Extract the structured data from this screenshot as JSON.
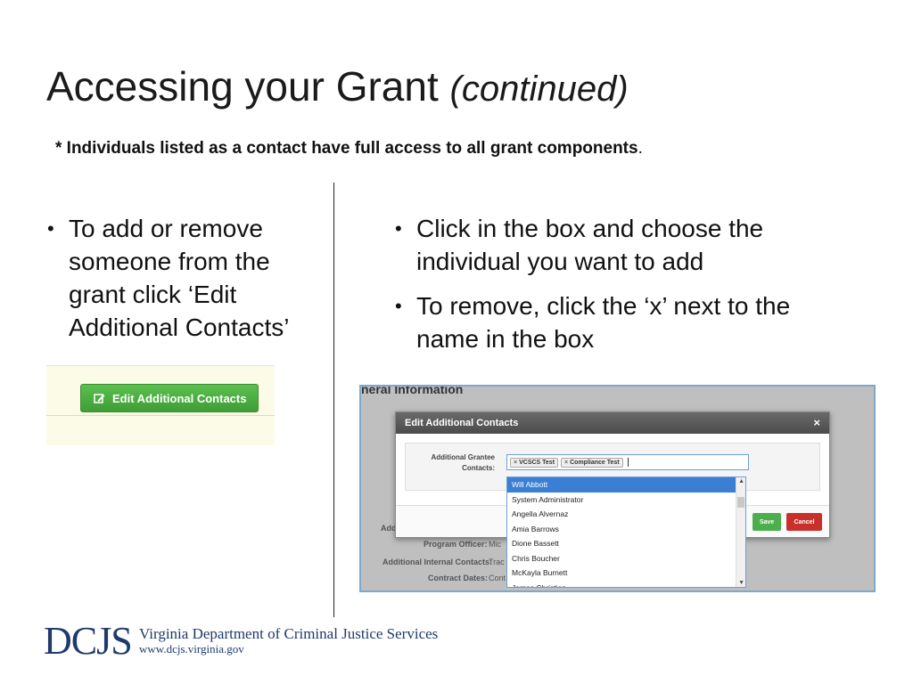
{
  "slide": {
    "title": "Accessing your Grant",
    "title_italic": "(continued)",
    "note_bold": "* Individuals listed as a contact have full access to all grant components",
    "note_end": "."
  },
  "left_bullets": [
    "To add or remove someone from the grant click ‘Edit Additional Contacts’"
  ],
  "right_bullets": [
    "Click in the box and choose the individual you want to add",
    "To remove, click the ‘x’ next to the name in the box"
  ],
  "screenshot_button": {
    "label": "Edit Additional Contacts",
    "icon": "edit-icon",
    "color": "#4cae4c"
  },
  "screenshot_modal": {
    "background_heading": "neral Information",
    "background_rows": [
      {
        "label": "Add",
        "value": ""
      },
      {
        "label": "Program Officer:",
        "value": "Mic"
      },
      {
        "label": "Additional Internal Contacts:",
        "value": "Trac"
      },
      {
        "label": "Contract Dates:",
        "value": "Cont"
      }
    ],
    "modal_title": "Edit Additional Contacts",
    "close_symbol": "×",
    "field_label": "Additional Grantee Contacts:",
    "tags": [
      "VCSCS Test",
      "Compliance Test"
    ],
    "tag_remove_symbol": "×",
    "dropdown_options": [
      "Will Abbott",
      "System Administrator",
      "Angella Alvernaz",
      "Amia Barrows",
      "Dione Bassett",
      "Chris Boucher",
      "McKayla Burnett",
      "James Christian"
    ],
    "selected_option": "Will Abbott",
    "save_label": "Save",
    "cancel_label": "Cancel"
  },
  "footer": {
    "logo_text": "DCJS",
    "org_name": "Virginia Department of Criminal Justice Services",
    "url": "www.dcjs.virginia.gov",
    "brand_color": "#1f3a6b"
  }
}
